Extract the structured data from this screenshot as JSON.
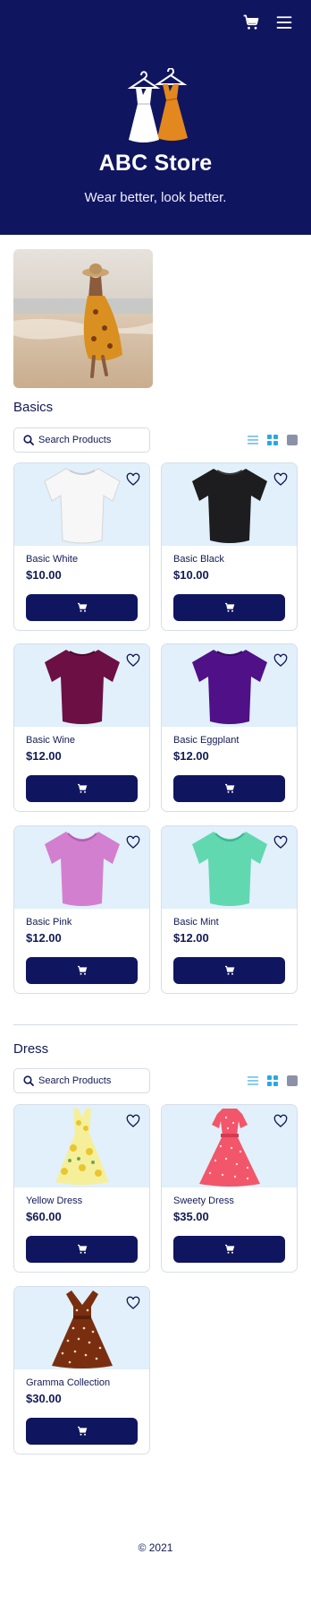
{
  "header": {
    "cart_icon": "cart-icon",
    "menu_icon": "hamburger-menu-icon",
    "title": "ABC Store",
    "tagline": "Wear better, look better."
  },
  "sections": [
    {
      "title": "Basics",
      "search_placeholder": "Search Products",
      "products": [
        {
          "name": "Basic White",
          "price": "$10.00",
          "color": "#f4f4f4"
        },
        {
          "name": "Basic Black",
          "price": "$10.00",
          "color": "#1d1d1f"
        },
        {
          "name": "Basic Wine",
          "price": "$12.00",
          "color": "#6b0f44"
        },
        {
          "name": "Basic Eggplant",
          "price": "$12.00",
          "color": "#4f1088"
        },
        {
          "name": "Basic Pink",
          "price": "$12.00",
          "color": "#d37fd0"
        },
        {
          "name": "Basic Mint",
          "price": "$12.00",
          "color": "#62d8b1"
        }
      ]
    },
    {
      "title": "Dress",
      "search_placeholder": "Search Products",
      "products": [
        {
          "name": "Yellow Dress",
          "price": "$60.00",
          "color": "#f2e04c"
        },
        {
          "name": "Sweety Dress",
          "price": "$35.00",
          "color": "#f2566a"
        },
        {
          "name": "Gramma Collection",
          "price": "$30.00",
          "color": "#7a2e10"
        }
      ]
    }
  ],
  "footer": {
    "copyright": "© 2021"
  },
  "colors": {
    "navy": "#101560",
    "card_bg": "#e1f0fa",
    "accent_blue": "#2aa8e0"
  }
}
